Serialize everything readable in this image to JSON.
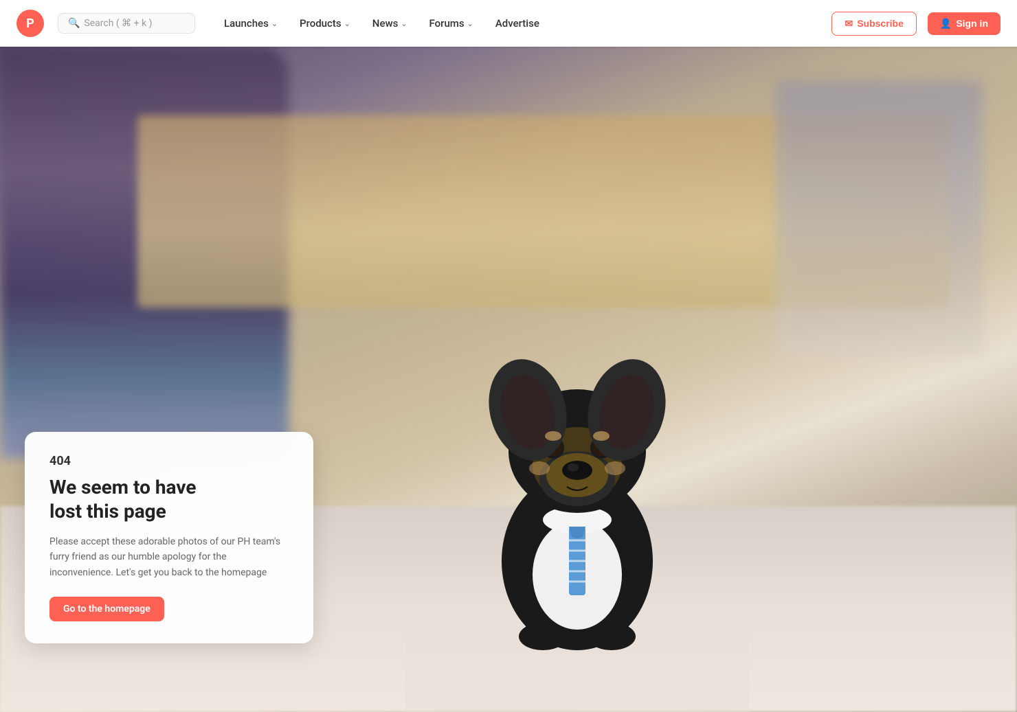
{
  "navbar": {
    "logo_letter": "P",
    "search_placeholder": "Search ( ⌘ + k )",
    "nav_items": [
      {
        "id": "launches",
        "label": "Launches",
        "has_chevron": true
      },
      {
        "id": "products",
        "label": "Products",
        "has_chevron": true
      },
      {
        "id": "news",
        "label": "News",
        "has_chevron": true
      },
      {
        "id": "forums",
        "label": "Forums",
        "has_chevron": true
      },
      {
        "id": "advertise",
        "label": "Advertise",
        "has_chevron": false
      }
    ],
    "subscribe_label": "Subscribe",
    "signin_label": "Sign in"
  },
  "error": {
    "code": "404",
    "title_line1": "We seem to have",
    "title_line2": "lost this page",
    "description": "Please accept these adorable photos of our PH team's furry friend as our humble apology for the inconvenience. Let's get you back to the homepage",
    "cta_label": "Go to the homepage"
  },
  "colors": {
    "brand": "#ff6154",
    "text_dark": "#222222",
    "text_medium": "#666666",
    "bg_white": "#ffffff"
  }
}
